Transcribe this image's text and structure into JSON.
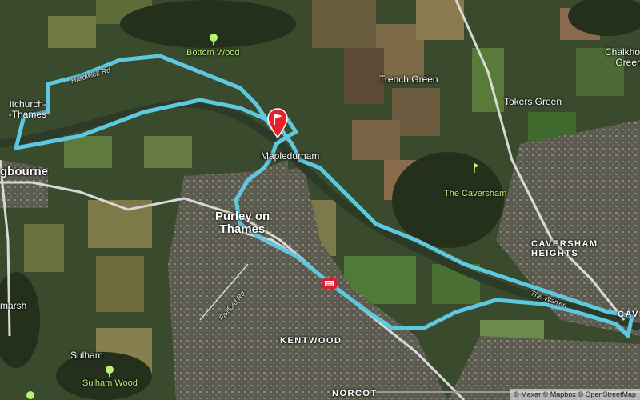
{
  "map": {
    "places": {
      "bottom_wood": "Bottom Wood",
      "trench_green": "Trench Green",
      "chalkhouse_green": "Chalkhouse\nGreen",
      "tokers_green": "Tokers Green",
      "whitchurch": "itchurch-\n-Thames",
      "pangbourne": "gbourne",
      "mapledurham": "Mapledurham",
      "the_caversham": "The Caversham",
      "purley": "Purley on\nThames",
      "caversham_heights": "CAVERSHAM\nHEIGHTS",
      "cave": "CAVE",
      "marsh": "marsh",
      "sulham": "Sulham",
      "sulham_wood": "Sulham Wood",
      "kentwood": "KENTWOOD",
      "norcot": "NORCOT"
    },
    "roads": {
      "hardwick_rd": "Hardwick Rd",
      "fairford_rd": "Fairford Rd",
      "the_warren": "The Warren"
    },
    "attribution": "© Maxar © Mapbox © OpenStreetMap",
    "colors": {
      "route": "#5ec8e0",
      "marker": "#e8202a",
      "road": "#d9d9d9"
    },
    "icons": [
      "tree-icon",
      "golf-icon",
      "flag-marker-icon",
      "station-icon"
    ]
  }
}
